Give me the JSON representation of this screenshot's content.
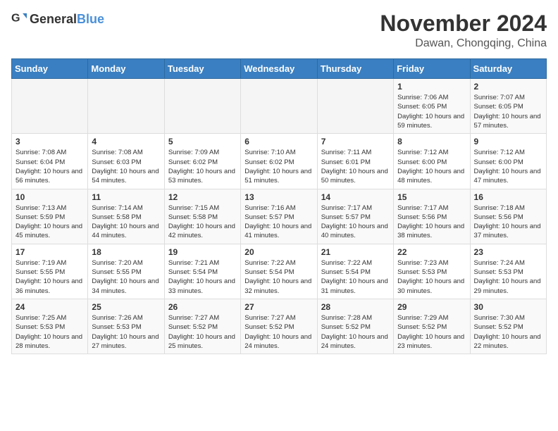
{
  "header": {
    "logo_general": "General",
    "logo_blue": "Blue",
    "main_title": "November 2024",
    "sub_title": "Dawan, Chongqing, China"
  },
  "weekdays": [
    "Sunday",
    "Monday",
    "Tuesday",
    "Wednesday",
    "Thursday",
    "Friday",
    "Saturday"
  ],
  "weeks": [
    [
      {
        "day": "",
        "info": ""
      },
      {
        "day": "",
        "info": ""
      },
      {
        "day": "",
        "info": ""
      },
      {
        "day": "",
        "info": ""
      },
      {
        "day": "",
        "info": ""
      },
      {
        "day": "1",
        "info": "Sunrise: 7:06 AM\nSunset: 6:05 PM\nDaylight: 10 hours and 59 minutes."
      },
      {
        "day": "2",
        "info": "Sunrise: 7:07 AM\nSunset: 6:05 PM\nDaylight: 10 hours and 57 minutes."
      }
    ],
    [
      {
        "day": "3",
        "info": "Sunrise: 7:08 AM\nSunset: 6:04 PM\nDaylight: 10 hours and 56 minutes."
      },
      {
        "day": "4",
        "info": "Sunrise: 7:08 AM\nSunset: 6:03 PM\nDaylight: 10 hours and 54 minutes."
      },
      {
        "day": "5",
        "info": "Sunrise: 7:09 AM\nSunset: 6:02 PM\nDaylight: 10 hours and 53 minutes."
      },
      {
        "day": "6",
        "info": "Sunrise: 7:10 AM\nSunset: 6:02 PM\nDaylight: 10 hours and 51 minutes."
      },
      {
        "day": "7",
        "info": "Sunrise: 7:11 AM\nSunset: 6:01 PM\nDaylight: 10 hours and 50 minutes."
      },
      {
        "day": "8",
        "info": "Sunrise: 7:12 AM\nSunset: 6:00 PM\nDaylight: 10 hours and 48 minutes."
      },
      {
        "day": "9",
        "info": "Sunrise: 7:12 AM\nSunset: 6:00 PM\nDaylight: 10 hours and 47 minutes."
      }
    ],
    [
      {
        "day": "10",
        "info": "Sunrise: 7:13 AM\nSunset: 5:59 PM\nDaylight: 10 hours and 45 minutes."
      },
      {
        "day": "11",
        "info": "Sunrise: 7:14 AM\nSunset: 5:58 PM\nDaylight: 10 hours and 44 minutes."
      },
      {
        "day": "12",
        "info": "Sunrise: 7:15 AM\nSunset: 5:58 PM\nDaylight: 10 hours and 42 minutes."
      },
      {
        "day": "13",
        "info": "Sunrise: 7:16 AM\nSunset: 5:57 PM\nDaylight: 10 hours and 41 minutes."
      },
      {
        "day": "14",
        "info": "Sunrise: 7:17 AM\nSunset: 5:57 PM\nDaylight: 10 hours and 40 minutes."
      },
      {
        "day": "15",
        "info": "Sunrise: 7:17 AM\nSunset: 5:56 PM\nDaylight: 10 hours and 38 minutes."
      },
      {
        "day": "16",
        "info": "Sunrise: 7:18 AM\nSunset: 5:56 PM\nDaylight: 10 hours and 37 minutes."
      }
    ],
    [
      {
        "day": "17",
        "info": "Sunrise: 7:19 AM\nSunset: 5:55 PM\nDaylight: 10 hours and 36 minutes."
      },
      {
        "day": "18",
        "info": "Sunrise: 7:20 AM\nSunset: 5:55 PM\nDaylight: 10 hours and 34 minutes."
      },
      {
        "day": "19",
        "info": "Sunrise: 7:21 AM\nSunset: 5:54 PM\nDaylight: 10 hours and 33 minutes."
      },
      {
        "day": "20",
        "info": "Sunrise: 7:22 AM\nSunset: 5:54 PM\nDaylight: 10 hours and 32 minutes."
      },
      {
        "day": "21",
        "info": "Sunrise: 7:22 AM\nSunset: 5:54 PM\nDaylight: 10 hours and 31 minutes."
      },
      {
        "day": "22",
        "info": "Sunrise: 7:23 AM\nSunset: 5:53 PM\nDaylight: 10 hours and 30 minutes."
      },
      {
        "day": "23",
        "info": "Sunrise: 7:24 AM\nSunset: 5:53 PM\nDaylight: 10 hours and 29 minutes."
      }
    ],
    [
      {
        "day": "24",
        "info": "Sunrise: 7:25 AM\nSunset: 5:53 PM\nDaylight: 10 hours and 28 minutes."
      },
      {
        "day": "25",
        "info": "Sunrise: 7:26 AM\nSunset: 5:53 PM\nDaylight: 10 hours and 27 minutes."
      },
      {
        "day": "26",
        "info": "Sunrise: 7:27 AM\nSunset: 5:52 PM\nDaylight: 10 hours and 25 minutes."
      },
      {
        "day": "27",
        "info": "Sunrise: 7:27 AM\nSunset: 5:52 PM\nDaylight: 10 hours and 24 minutes."
      },
      {
        "day": "28",
        "info": "Sunrise: 7:28 AM\nSunset: 5:52 PM\nDaylight: 10 hours and 24 minutes."
      },
      {
        "day": "29",
        "info": "Sunrise: 7:29 AM\nSunset: 5:52 PM\nDaylight: 10 hours and 23 minutes."
      },
      {
        "day": "30",
        "info": "Sunrise: 7:30 AM\nSunset: 5:52 PM\nDaylight: 10 hours and 22 minutes."
      }
    ]
  ]
}
